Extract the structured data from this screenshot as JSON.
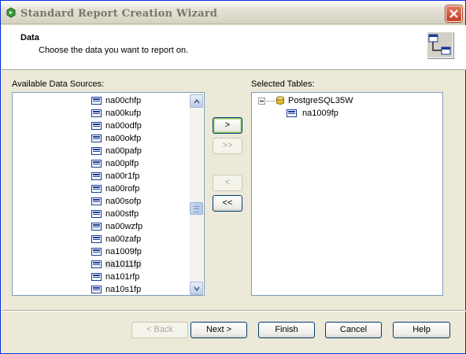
{
  "window": {
    "title": "Standard Report Creation Wizard",
    "title_icon": "wizard-app-icon",
    "close_icon": "close-x-icon"
  },
  "header": {
    "title": "Data",
    "subtitle": "Choose the data you want to report on.",
    "icon": "table-link-icon"
  },
  "available": {
    "label": "Available Data Sources:",
    "items": [
      {
        "label": "na00chfp",
        "selected": false
      },
      {
        "label": "na00kufp",
        "selected": false
      },
      {
        "label": "na00odfp",
        "selected": false
      },
      {
        "label": "na00okfp",
        "selected": false
      },
      {
        "label": "na00pafp",
        "selected": false
      },
      {
        "label": "na00plfp",
        "selected": false
      },
      {
        "label": "na00r1fp",
        "selected": false
      },
      {
        "label": "na00rofp",
        "selected": false
      },
      {
        "label": "na00sofp",
        "selected": false
      },
      {
        "label": "na00stfp",
        "selected": false
      },
      {
        "label": "na00wzfp",
        "selected": false
      },
      {
        "label": "na00zafp",
        "selected": false
      },
      {
        "label": "na1009fp",
        "selected": false
      },
      {
        "label": "na1011fp",
        "selected": true
      },
      {
        "label": "na101rfp",
        "selected": false
      },
      {
        "label": "na10s1fp",
        "selected": false
      }
    ]
  },
  "transfer": {
    "add_one": ">",
    "add_all": ">>",
    "remove_one": "<",
    "remove_all": "<<"
  },
  "selected": {
    "label": "Selected Tables:",
    "connection": "PostgreSQL35W",
    "tables": [
      "na1009fp"
    ]
  },
  "footer": {
    "back": "< Back",
    "next": "Next >",
    "finish": "Finish",
    "cancel": "Cancel",
    "help": "Help"
  },
  "colors": {
    "accent_border": "#7f9db9",
    "button_border": "#003c74",
    "window_bg": "#ece9d8",
    "close_red": "#c5432a"
  }
}
